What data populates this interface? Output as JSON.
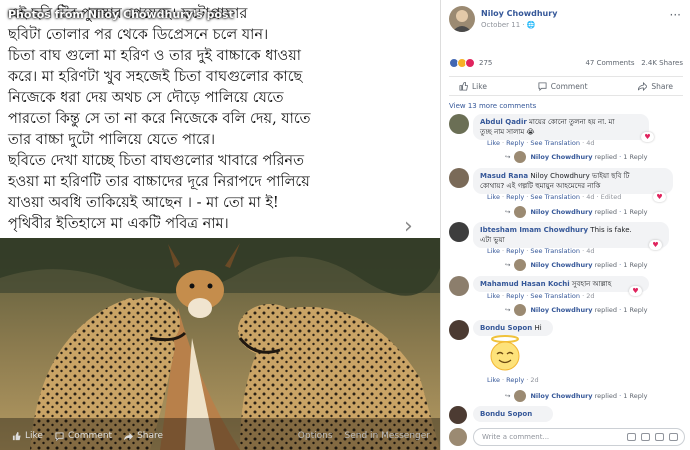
{
  "photo": {
    "source_label": "Photos from Niloy Chowdhury's post",
    "body_lines": [
      "এই ছবি টির পুরস্কার পেয়েছে। ফটোগ্রাফার",
      "ছবিটা তোলার পর থেকে ডিপ্রেসনে চলে যান।",
      "চিতা বাঘ গুলো মা হরিণ ও তার দুই বাচ্চাকে ধাওয়া",
      "করে। মা হরিণটা খুব সহজেই চিতা বাঘগুলোর কাছে",
      "নিজেকে ধরা দেয় অথচ সে দৌড়ে পালিয়ে যেতে",
      "পারতো কিন্তু সে তা না করে নিজেকে বলি দেয়, যাতে",
      "তার বাচ্চা দুটো পালিয়ে যেতে পারে।",
      "ছবিতে দেখা যাচ্ছে চিতা বাঘগুলোর খাবারে পরিনত",
      "হওয়া মা হরিণটি তার বাচ্চাদের দূরে নিরাপদে পালিয়ে",
      "যাওয়া অবধি তাকিয়েই আছেন । - মা তো মা ই!",
      "পৃথিবীর ইতিহাসে মা একটি পবিত্র নাম।"
    ],
    "actions": {
      "like": "Like",
      "comment": "Comment",
      "share": "Share",
      "options": "Options",
      "send": "Send in Messenger"
    }
  },
  "post": {
    "author": "Niloy Chowdhury",
    "date": "October 11 · 🌐",
    "menu": "···",
    "reaction_count": "275",
    "comments_count": "47 Comments",
    "shares_count": "2.4K Shares",
    "like_label": "Like",
    "comment_label": "Comment",
    "share_label": "Share",
    "view_more": "View 13 more comments"
  },
  "comments": [
    {
      "name": "Abdul Qadir",
      "text1": "মায়ের কোনো তুলনা হয় না. মা",
      "text2": "তুচ্ছ নাম সালাম 😭",
      "meta_like": "Like",
      "meta_reply": "Reply",
      "meta_extra": "See Translation",
      "meta_time": "4d",
      "reply_author": "Niloy Chowdhury",
      "reply_word": "replied",
      "reply_count": "1 Reply"
    },
    {
      "name": "Masud Rana",
      "text1": "Niloy Chowdhury ভাইয়া ছবি টি",
      "text2": "কোথায়? এই গল্পটি হুমায়ুন আহমেদের নাকি",
      "meta_like": "Like",
      "meta_reply": "Reply",
      "meta_extra": "See Translation",
      "meta_time": "4d · Edited",
      "reply_author": "Niloy Chowdhury",
      "reply_word": "replied",
      "reply_count": "1 Reply"
    },
    {
      "name": "Ibtesham Imam Chowdhury",
      "text1": "This is fake.",
      "text2": "এটা ভুয়া",
      "meta_like": "Like",
      "meta_reply": "Reply",
      "meta_extra": "See Translation",
      "meta_time": "4d",
      "reply_author": "Niloy Chowdhury",
      "reply_word": "replied",
      "reply_count": "1 Reply"
    },
    {
      "name": "Mahamud Hasan Kochi",
      "text1": "সুবহান আল্লাহ",
      "text2": "",
      "meta_like": "Like",
      "meta_reply": "Reply",
      "meta_extra": "See Translation",
      "meta_time": "2d",
      "reply_author": "Niloy Chowdhury",
      "reply_word": "replied",
      "reply_count": "1 Reply"
    },
    {
      "name": "Bondu Sopon",
      "text1": "Hi",
      "text2": "",
      "meta_like": "Like",
      "meta_reply": "Reply",
      "meta_extra": "",
      "meta_time": "2d",
      "reply_author": "Niloy Chowdhury",
      "reply_word": "replied",
      "reply_count": "1 Reply"
    },
    {
      "name": "Bondu Sopon",
      "text1": "",
      "text2": "",
      "meta_like": "",
      "meta_reply": "",
      "meta_extra": "",
      "meta_time": "",
      "reply_author": "",
      "reply_word": "",
      "reply_count": ""
    }
  ],
  "composer": {
    "placeholder": "Write a comment..."
  },
  "colors": {
    "link": "#365899",
    "muted": "#90949c",
    "bubble": "#f2f3f5",
    "love": "#e0245e"
  }
}
